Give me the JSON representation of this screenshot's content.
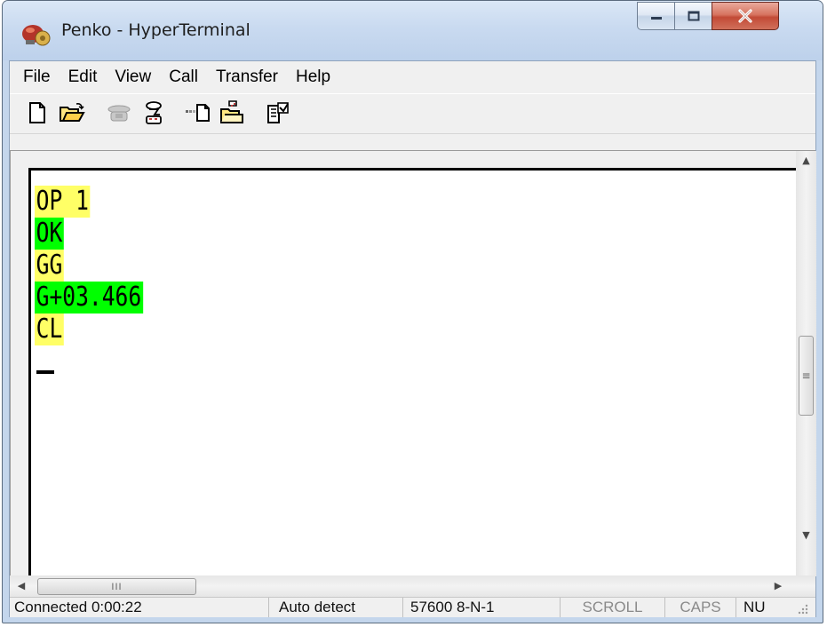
{
  "window": {
    "title": "Penko - HyperTerminal"
  },
  "menu": [
    {
      "label": "File"
    },
    {
      "label": "Edit"
    },
    {
      "label": "View"
    },
    {
      "label": "Call"
    },
    {
      "label": "Transfer"
    },
    {
      "label": "Help"
    }
  ],
  "toolbar": [
    {
      "icon": "new-document-icon"
    },
    {
      "icon": "open-folder-icon"
    },
    {
      "icon": "phone-call-icon"
    },
    {
      "icon": "disconnect-icon"
    },
    {
      "icon": "send-icon"
    },
    {
      "icon": "receive-icon"
    },
    {
      "icon": "properties-icon"
    }
  ],
  "terminal": {
    "lines": [
      {
        "text": "OP 1",
        "highlight": "yellow"
      },
      {
        "text": "OK",
        "highlight": "green"
      },
      {
        "text": "GG",
        "highlight": "yellow"
      },
      {
        "text": "G+03.466",
        "highlight": "green"
      },
      {
        "text": "CL",
        "highlight": "yellow"
      }
    ],
    "colors": {
      "yellow": "#ffff66",
      "green": "#00ff00"
    }
  },
  "scrollbars": {
    "thumb_grip": "III",
    "vertical_grip": "≡"
  },
  "status": {
    "connection": "Connected 0:00:22",
    "detect": "Auto detect",
    "port_settings": "57600 8-N-1",
    "scroll": "SCROLL",
    "caps": "CAPS",
    "num": "NU"
  }
}
